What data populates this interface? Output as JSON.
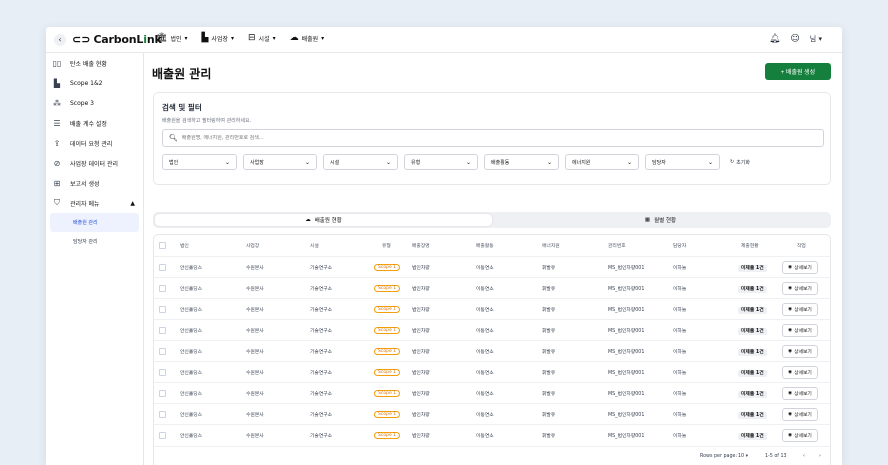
{
  "header": {
    "back_icon": "chevron-left-icon",
    "logo": {
      "text_main": "CarbonL",
      "text_accent": "i",
      "text_tail": "nk"
    },
    "nav": [
      {
        "icon": "building-icon",
        "label": "법인"
      },
      {
        "icon": "factory-icon",
        "label": "사업장"
      },
      {
        "icon": "facility-icon",
        "label": "시설"
      },
      {
        "icon": "cloud-icon",
        "label": "배출원"
      }
    ],
    "bell_icon": "bell-icon",
    "user_icon": "user-icon",
    "user_label": "님"
  },
  "sidebar": {
    "items": [
      {
        "icon": "dashboard-icon",
        "label": "탄소 배출 현황"
      },
      {
        "icon": "chart-icon",
        "label": "Scope 1&2"
      },
      {
        "icon": "network-icon",
        "label": "Scope 3"
      },
      {
        "icon": "list-icon",
        "label": "배출 계수 설정"
      },
      {
        "icon": "upload-icon",
        "label": "데이터 요청 관리"
      },
      {
        "icon": "check-circle-icon",
        "label": "사업장 데이터 관리"
      },
      {
        "icon": "report-icon",
        "label": "보고서 생성"
      },
      {
        "icon": "shield-icon",
        "label": "관리자 메뉴"
      }
    ],
    "sub_items": [
      {
        "label": "배출원 관리",
        "active": true
      },
      {
        "label": "담당자 관리",
        "active": false
      }
    ]
  },
  "main": {
    "title": "배출원 관리",
    "add_button": "+ 배출원 생성",
    "filter": {
      "title": "검색 및 필터",
      "description": "배출원을 검색하고 필터링하여 관리하세요.",
      "search_placeholder": "배출원명, 에너지원, 관리번호로 검색...",
      "selects": [
        "법인",
        "사업장",
        "시설",
        "유형",
        "배출활동",
        "에너지원",
        "담당자"
      ],
      "reset_label": "초기화"
    },
    "tabs": [
      {
        "icon": "cloud-icon",
        "label": "배출원 현황",
        "active": true
      },
      {
        "icon": "calendar-icon",
        "label": "월별 현황",
        "active": false
      }
    ],
    "table": {
      "columns": [
        "법인",
        "사업장",
        "시설",
        "유형",
        "배출장명",
        "배출활동",
        "에너지원",
        "관리번호",
        "담당자",
        "제출현황",
        "작업"
      ],
      "rows": [
        [
          "안신홀딩스",
          "수원본사",
          "기술연구소",
          "Scope 1",
          "법인차량",
          "이동연소",
          "휘발유",
          "MS_법인차량001",
          "이하늘",
          "미제출 1건",
          "상세보기"
        ],
        [
          "안신홀딩스",
          "수원본사",
          "기술연구소",
          "Scope 1",
          "법인차량",
          "이동연소",
          "휘발유",
          "MS_법인차량001",
          "이하늘",
          "미제출 1건",
          "상세보기"
        ],
        [
          "안신홀딩스",
          "수원본사",
          "기술연구소",
          "Scope 1",
          "법인차량",
          "이동연소",
          "휘발유",
          "MS_법인차량001",
          "이하늘",
          "미제출 1건",
          "상세보기"
        ],
        [
          "안신홀딩스",
          "수원본사",
          "기술연구소",
          "Scope 1",
          "법인차량",
          "이동연소",
          "휘발유",
          "MS_법인차량001",
          "이하늘",
          "미제출 1건",
          "상세보기"
        ],
        [
          "안신홀딩스",
          "수원본사",
          "기술연구소",
          "Scope 1",
          "법인차량",
          "이동연소",
          "휘발유",
          "MS_법인차량001",
          "이하늘",
          "미제출 1건",
          "상세보기"
        ],
        [
          "안신홀딩스",
          "수원본사",
          "기술연구소",
          "Scope 1",
          "법인차량",
          "이동연소",
          "휘발유",
          "MS_법인차량001",
          "이하늘",
          "미제출 1건",
          "상세보기"
        ],
        [
          "안신홀딩스",
          "수원본사",
          "기술연구소",
          "Scope 1",
          "법인차량",
          "이동연소",
          "휘발유",
          "MS_법인차량001",
          "이하늘",
          "미제출 1건",
          "상세보기"
        ],
        [
          "안신홀딩스",
          "수원본사",
          "기술연구소",
          "Scope 1",
          "법인차량",
          "이동연소",
          "휘발유",
          "MS_법인차량001",
          "이하늘",
          "미제출 1건",
          "상세보기"
        ],
        [
          "안신홀딩스",
          "수원본사",
          "기술연구소",
          "Scope 1",
          "법인차량",
          "이동연소",
          "휘발유",
          "MS_법인차량001",
          "이하늘",
          "미제출 1건",
          "상세보기"
        ]
      ]
    },
    "pagination": {
      "rows_per_page_label": "Rows per page:",
      "rows_per_page_value": "10",
      "range": "1-5 of 13"
    }
  },
  "colors": {
    "accent": "#15803d",
    "scope_badge": "#f59e0b"
  }
}
